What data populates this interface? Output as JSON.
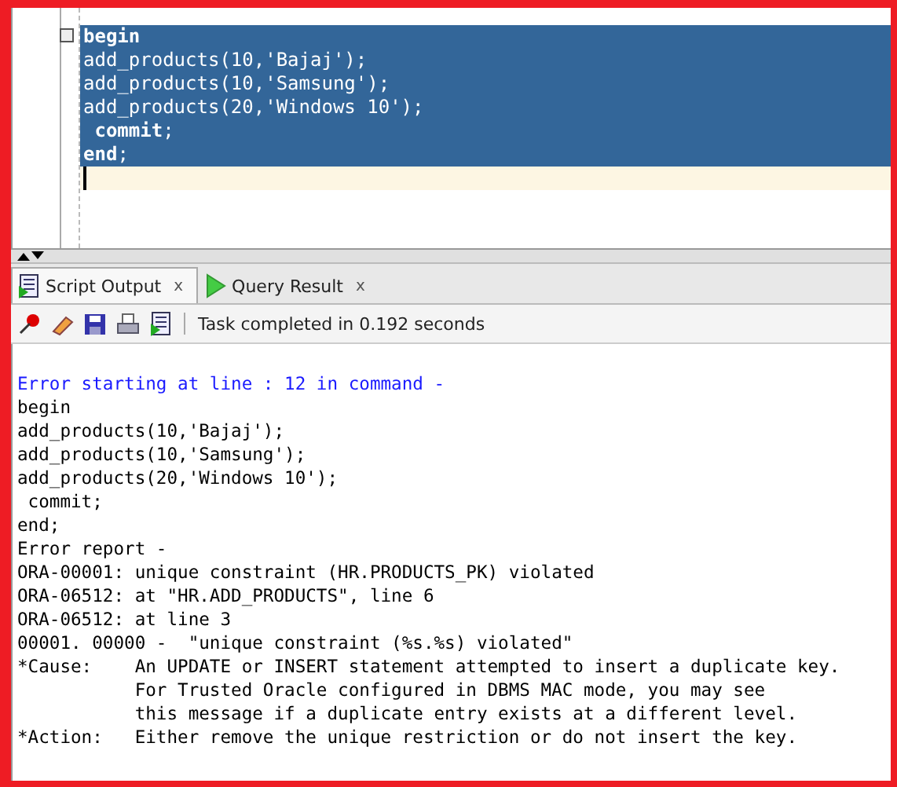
{
  "editor": {
    "lines": [
      {
        "text": "begin",
        "bold": true,
        "selected": true
      },
      {
        "text": "add_products(10,'Bajaj');",
        "bold": false,
        "selected": true
      },
      {
        "text": "add_products(10,'Samsung');",
        "bold": false,
        "selected": true
      },
      {
        "text": "add_products(20,'Windows 10');",
        "bold": false,
        "selected": true
      },
      {
        "text": " **commit**;",
        "bold": false,
        "selected": true
      },
      {
        "text": "**end**;",
        "bold": false,
        "selected": true
      }
    ]
  },
  "tabs": [
    {
      "label": "Script Output",
      "close": "x",
      "kind": "script",
      "selected": true
    },
    {
      "label": "Query Result",
      "close": "x",
      "kind": "query",
      "selected": false
    }
  ],
  "toolbar": {
    "status": "Task completed in 0.192 seconds"
  },
  "output": [
    {
      "text": "Error starting at line : 12 in command -",
      "kind": "info"
    },
    {
      "text": "begin",
      "kind": "plain"
    },
    {
      "text": "add_products(10,'Bajaj');",
      "kind": "plain"
    },
    {
      "text": "add_products(10,'Samsung');",
      "kind": "plain"
    },
    {
      "text": "add_products(20,'Windows 10');",
      "kind": "plain"
    },
    {
      "text": " commit;",
      "kind": "plain"
    },
    {
      "text": "end;",
      "kind": "plain"
    },
    {
      "text": "Error report -",
      "kind": "plain"
    },
    {
      "text": "ORA-00001: unique constraint (HR.PRODUCTS_PK) violated",
      "kind": "plain"
    },
    {
      "text": "ORA-06512: at \"HR.ADD_PRODUCTS\", line 6",
      "kind": "plain"
    },
    {
      "text": "ORA-06512: at line 3",
      "kind": "plain"
    },
    {
      "text": "00001. 00000 -  \"unique constraint (%s.%s) violated\"",
      "kind": "plain"
    },
    {
      "text": "*Cause:    An UPDATE or INSERT statement attempted to insert a duplicate key.",
      "kind": "plain"
    },
    {
      "text": "           For Trusted Oracle configured in DBMS MAC mode, you may see",
      "kind": "plain"
    },
    {
      "text": "           this message if a duplicate entry exists at a different level.",
      "kind": "plain"
    },
    {
      "text": "*Action:   Either remove the unique restriction or do not insert the key.",
      "kind": "plain"
    }
  ]
}
